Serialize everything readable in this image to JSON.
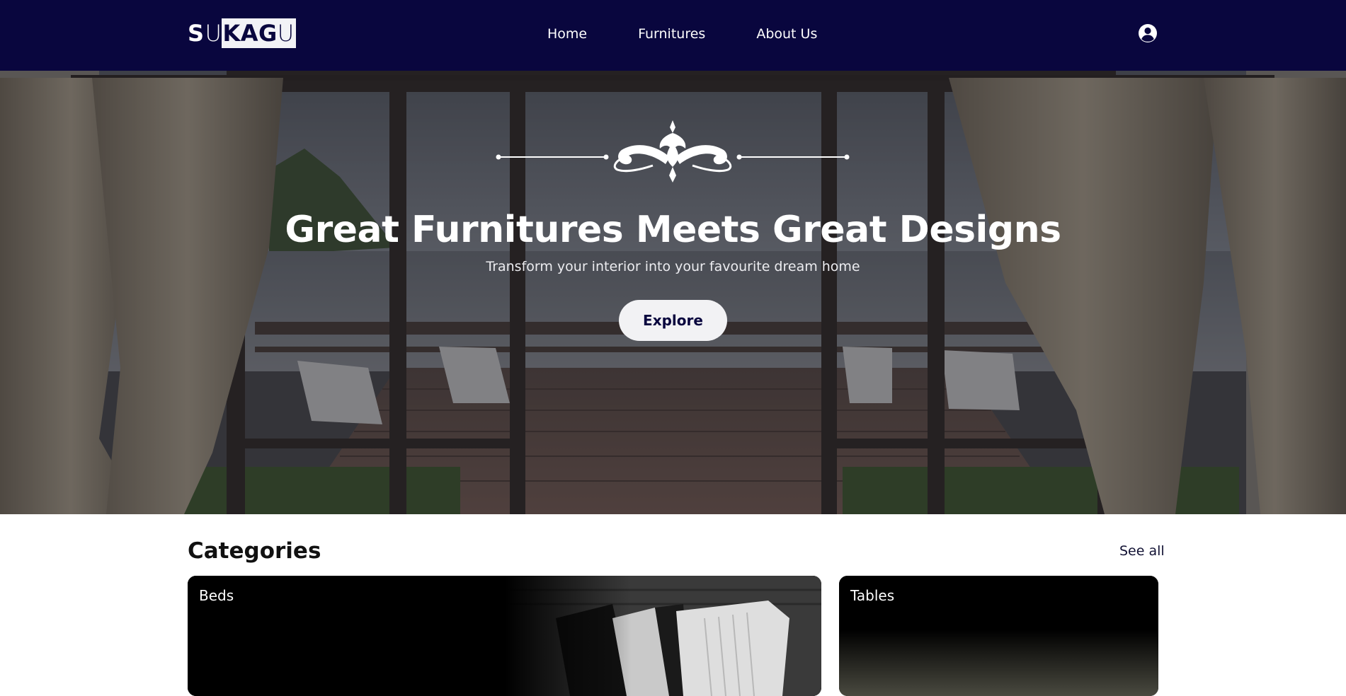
{
  "brand": {
    "logo_part_a": "S",
    "logo_part_b": "U",
    "logo_part_c_bold": "KAG",
    "logo_part_c_thin": "U"
  },
  "nav": {
    "items": [
      {
        "label": "Home"
      },
      {
        "label": "Furnitures"
      },
      {
        "label": "About Us"
      }
    ],
    "account_icon": "user-circle-icon"
  },
  "hero": {
    "title": "Great Furnitures Meets Great Designs",
    "subtitle": "Transform your interior into your favourite dream home",
    "cta_label": "Explore",
    "ornament_icon": "flourish-divider-icon"
  },
  "categories": {
    "title": "Categories",
    "see_all": "See all",
    "items": [
      {
        "label": "Beds"
      },
      {
        "label": "Tables"
      }
    ]
  },
  "colors": {
    "navbar_bg": "#09063e",
    "accent_text": "#09063e",
    "button_bg": "#f2f2f4",
    "white": "#ffffff"
  }
}
